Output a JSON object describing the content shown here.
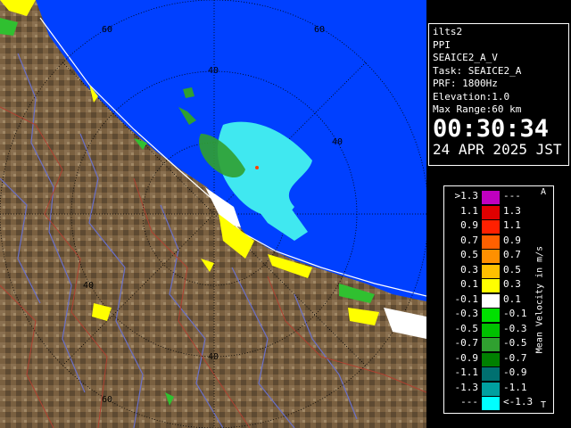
{
  "info": {
    "site": "ilts2",
    "product": "PPI",
    "scan": "SEAICE2_A_V",
    "task": "Task: SEAICE2_A",
    "prf": "PRF: 1800Hz",
    "elevation": "Elevation:1.0",
    "max_range": "Max Range:60 km",
    "time": "00:30:34",
    "date": "24 APR 2025 JST"
  },
  "legend": {
    "title": "Mean Velocity in m/s",
    "corner_top": "A",
    "corner_bottom": "T",
    "rows": [
      {
        "lo": ">1.3",
        "hi": "---",
        "color": "#c000c0"
      },
      {
        "lo": "1.1",
        "hi": "1.3",
        "color": "#e00000"
      },
      {
        "lo": "0.9",
        "hi": "1.1",
        "color": "#ff2000"
      },
      {
        "lo": "0.7",
        "hi": "0.9",
        "color": "#ff6000"
      },
      {
        "lo": "0.5",
        "hi": "0.7",
        "color": "#ff9000"
      },
      {
        "lo": "0.3",
        "hi": "0.5",
        "color": "#ffc000"
      },
      {
        "lo": "0.1",
        "hi": "0.3",
        "color": "#ffff00"
      },
      {
        "lo": "-0.1",
        "hi": "0.1",
        "color": "#ffffff"
      },
      {
        "lo": "-0.3",
        "hi": "-0.1",
        "color": "#00e000"
      },
      {
        "lo": "-0.5",
        "hi": "-0.3",
        "color": "#00c000"
      },
      {
        "lo": "-0.7",
        "hi": "-0.5",
        "color": "#30a030"
      },
      {
        "lo": "-0.9",
        "hi": "-0.7",
        "color": "#008000"
      },
      {
        "lo": "-1.1",
        "hi": "-0.9",
        "color": "#007070"
      },
      {
        "lo": "-1.3",
        "hi": "-1.1",
        "color": "#00a0a0"
      },
      {
        "lo": "---",
        "hi": "<-1.3",
        "color": "#00ffff"
      }
    ]
  },
  "range_labels": [
    "60",
    "40",
    "40",
    "40",
    "40",
    "60",
    "60"
  ],
  "colors": {
    "sea": "#0040ff",
    "land": "#7a6040",
    "echo_main": "#40e8f0"
  }
}
